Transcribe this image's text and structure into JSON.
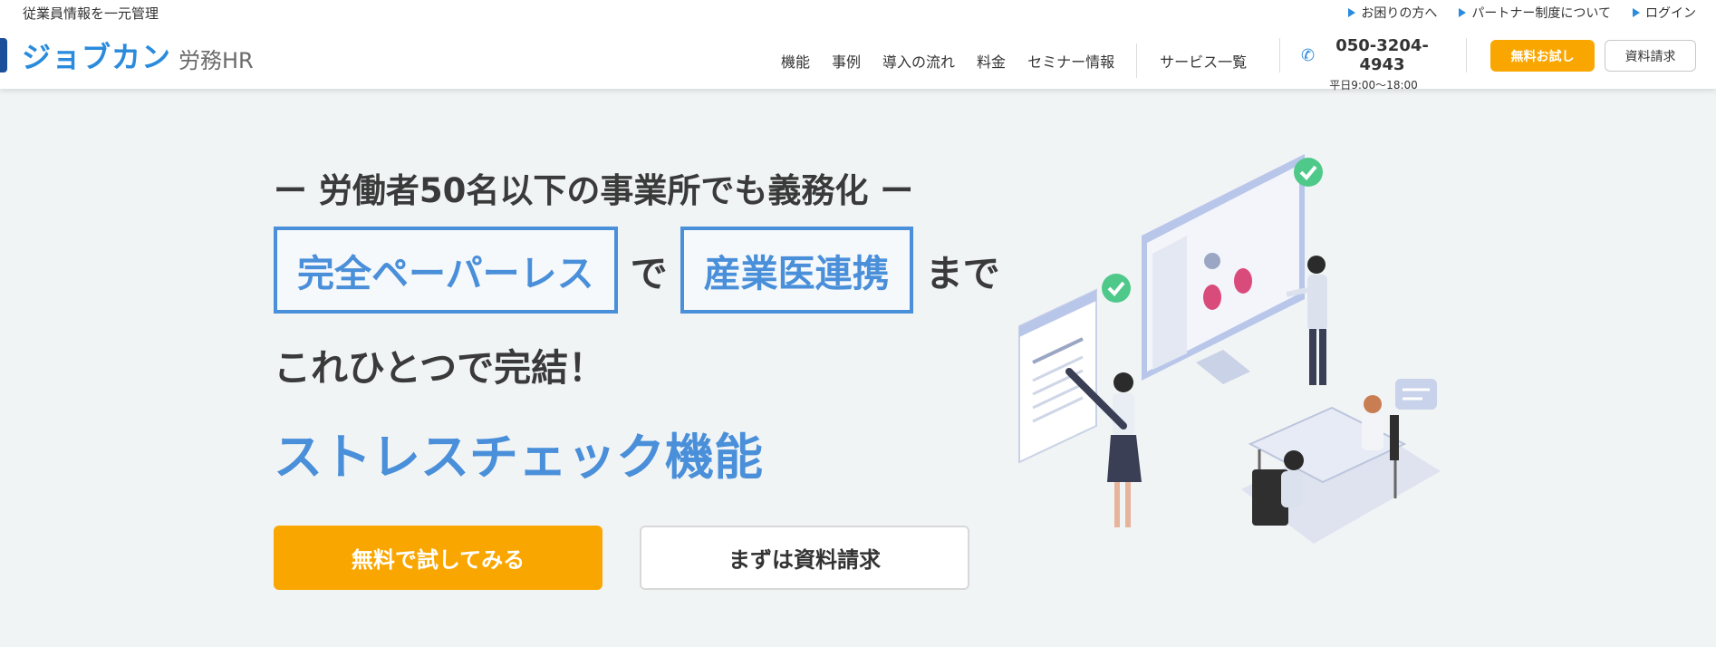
{
  "header": {
    "tagline": "従業員情報を一元管理",
    "logo_main": "ジョブカン",
    "logo_sub": "労務HR",
    "top_links": [
      "お困りの方へ",
      "パートナー制度について",
      "ログイン"
    ],
    "nav": [
      "機能",
      "事例",
      "導入の流れ",
      "料金",
      "セミナー情報"
    ],
    "service_list": "サービス一覧",
    "phone": "050-3204-4943",
    "phone_hours": "平日9:00～18:00",
    "trial_button": "無料お試し",
    "doc_button": "資料請求"
  },
  "hero": {
    "sub_heading": "ー 労働者50名以下の事業所でも義務化 ー",
    "boxed_1": "完全ペーパーレス",
    "joiner_1": "で",
    "boxed_2": "産業医連携",
    "joiner_2": "まで",
    "line_3": "これひとつで完結！",
    "feature": "ストレスチェック機能",
    "cta_trial": "無料で試してみる",
    "cta_doc": "まずは資料請求"
  },
  "colors": {
    "accent": "#4a8fd9",
    "logo_blue": "#2a8bdc",
    "cta_orange": "#faa600",
    "background": "#f1f4f5",
    "check_green": "#4fc98a"
  },
  "icons": [
    "triangle-arrow-icon",
    "phone-icon",
    "check-badge-icon"
  ]
}
